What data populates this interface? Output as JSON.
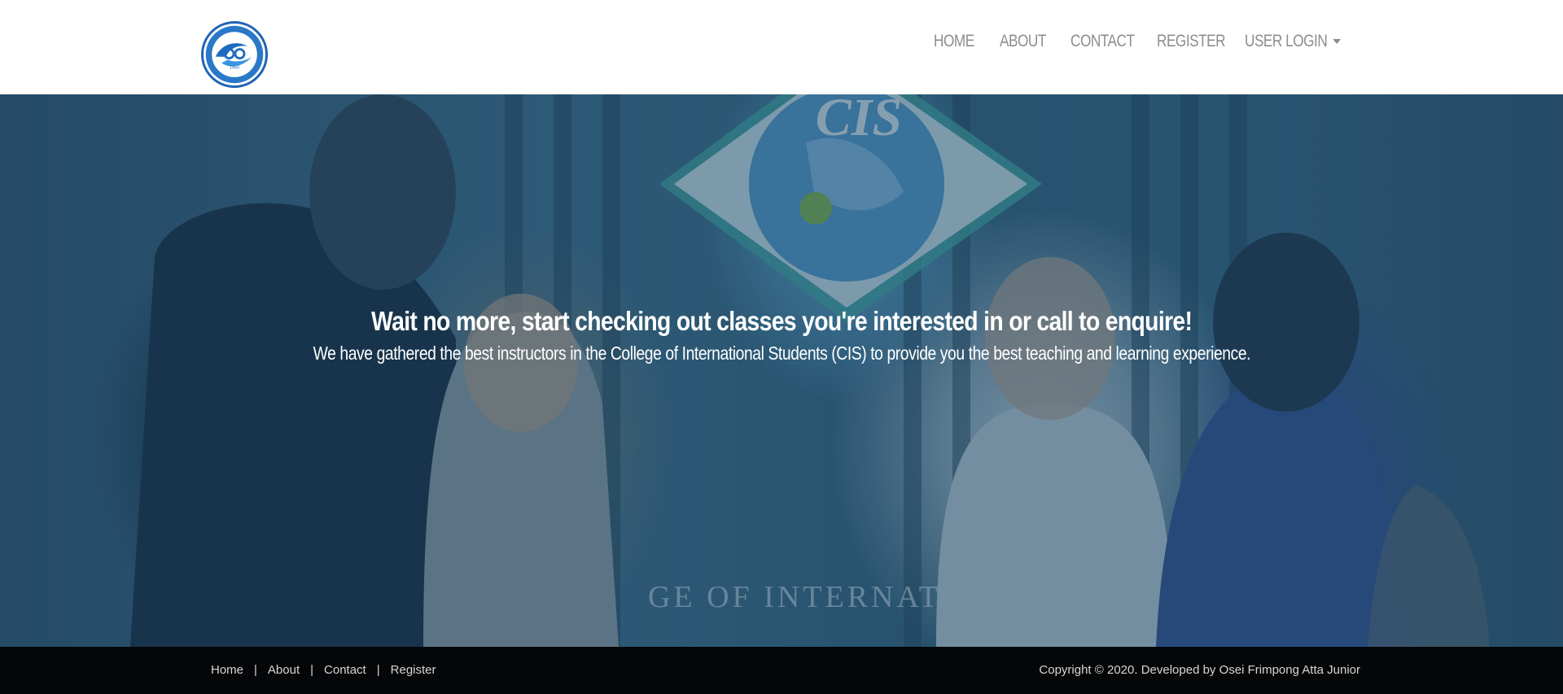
{
  "header": {
    "logo_year": "1960",
    "nav": {
      "home": "HOME",
      "about": "ABOUT",
      "contact": "CONTACT",
      "register": "REGISTER",
      "user_login": "USER LOGIN"
    }
  },
  "hero": {
    "title": "Wait no more, start checking out classes you're interested in or call to enquire!",
    "subtitle": "We have gathered the best instructors in the College of International Students (CIS) to provide you the best teaching and learning experience.",
    "sign_text": "CIS",
    "wall_text": "GE OF INTERNATIO"
  },
  "footer": {
    "links": [
      "Home",
      "About",
      "Contact",
      "Register"
    ],
    "separator": "|",
    "copyright": "Copyright © 2020. Developed by Osei Frimpong Atta Junior"
  },
  "colors": {
    "nav_text": "#8d8d8d",
    "hero_overlay": "#1e4664",
    "footer_bg": "#050608",
    "footer_text": "#d6d6d6",
    "logo_blue": "#1e63b5"
  }
}
